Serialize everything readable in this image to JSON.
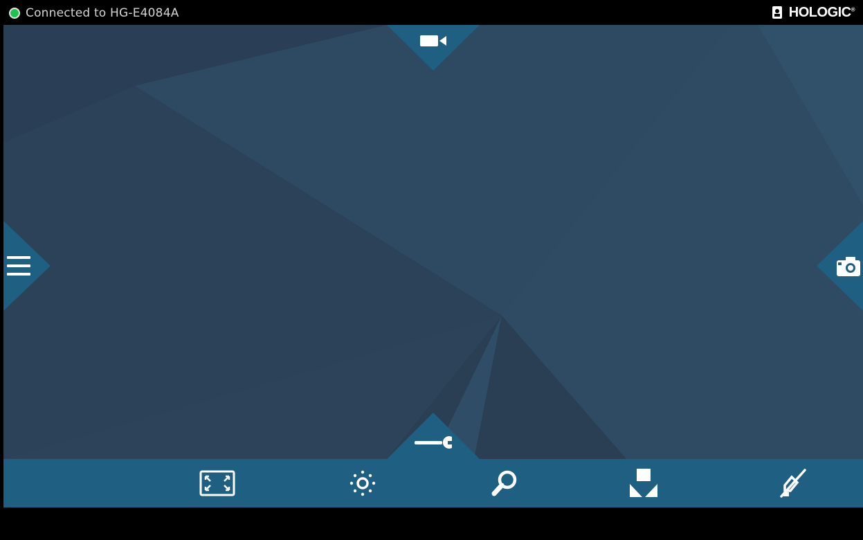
{
  "status_bar": {
    "connection_text": "Connected to HG-E4084A",
    "connection_state": "connected",
    "indicator_color": "#1fc24a"
  },
  "brand": {
    "name": "HOLOGIC",
    "trademark": "®",
    "icon": "battery-icon"
  },
  "colors": {
    "panel_accent": "#1e5f82",
    "background": "#2c435a"
  },
  "edge_controls": {
    "top": {
      "icon": "video-camera-icon"
    },
    "left": {
      "icon": "menu-icon"
    },
    "right": {
      "icon": "camera-icon"
    },
    "bottom": {
      "icon": "wrench-icon"
    }
  },
  "toolbar": {
    "buttons": [
      {
        "icon": "fit-screen-icon"
      },
      {
        "icon": "brightness-icon"
      },
      {
        "icon": "magnifier-icon"
      },
      {
        "icon": "capture-down-icon"
      },
      {
        "icon": "pen-disabled-icon"
      }
    ]
  }
}
